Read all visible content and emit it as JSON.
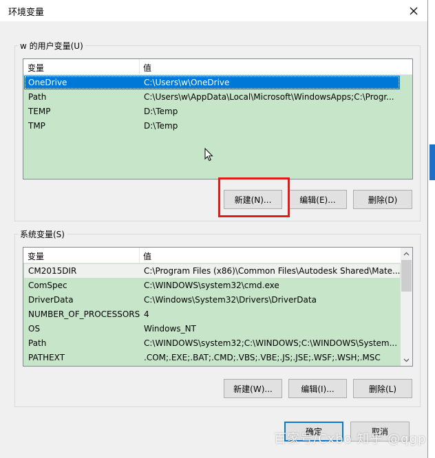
{
  "window": {
    "title": "环境变量"
  },
  "user_vars": {
    "group_label": "w 的用户变量(U)",
    "col_name": "变量",
    "col_value": "值",
    "rows": [
      {
        "name": "OneDrive",
        "value": "C:\\Users\\w\\OneDrive"
      },
      {
        "name": "Path",
        "value": "C:\\Users\\w\\AppData\\Local\\Microsoft\\WindowsApps;C:\\Progr..."
      },
      {
        "name": "TEMP",
        "value": "D:\\Temp"
      },
      {
        "name": "TMP",
        "value": "D:\\Temp"
      }
    ],
    "selected_index": 0,
    "buttons": {
      "new": "新建(N)...",
      "edit": "编辑(E)...",
      "delete": "删除(D)"
    }
  },
  "system_vars": {
    "group_label": "系统变量(S)",
    "col_name": "变量",
    "col_value": "值",
    "rows": [
      {
        "name": "CM2015DIR",
        "value": "C:\\Program Files (x86)\\Common Files\\Autodesk Shared\\Mate..."
      },
      {
        "name": "ComSpec",
        "value": "C:\\WINDOWS\\system32\\cmd.exe"
      },
      {
        "name": "DriverData",
        "value": "C:\\Windows\\System32\\Drivers\\DriverData"
      },
      {
        "name": "NUMBER_OF_PROCESSORS",
        "value": "4"
      },
      {
        "name": "OS",
        "value": "Windows_NT"
      },
      {
        "name": "Path",
        "value": "C:\\WINDOWS\\system32;C:\\WINDOWS;C:\\WINDOWS\\System..."
      },
      {
        "name": "PATHEXT",
        "value": ".COM;.EXE;.BAT;.CMD;.VBS;.VBE;.JS;.JSE;.WSF;.WSH;.MSC"
      }
    ],
    "buttons": {
      "new": "新建(W)...",
      "edit": "编辑(I)...",
      "delete": "删除(L)"
    }
  },
  "footer": {
    "ok": "确定",
    "cancel": "取消"
  },
  "watermark": "百家号/Cxbo 知乎 @qgp",
  "colors": {
    "list_bg": "#c7e5c9",
    "selection": "#0078d7",
    "highlight": "#e21a1a"
  }
}
